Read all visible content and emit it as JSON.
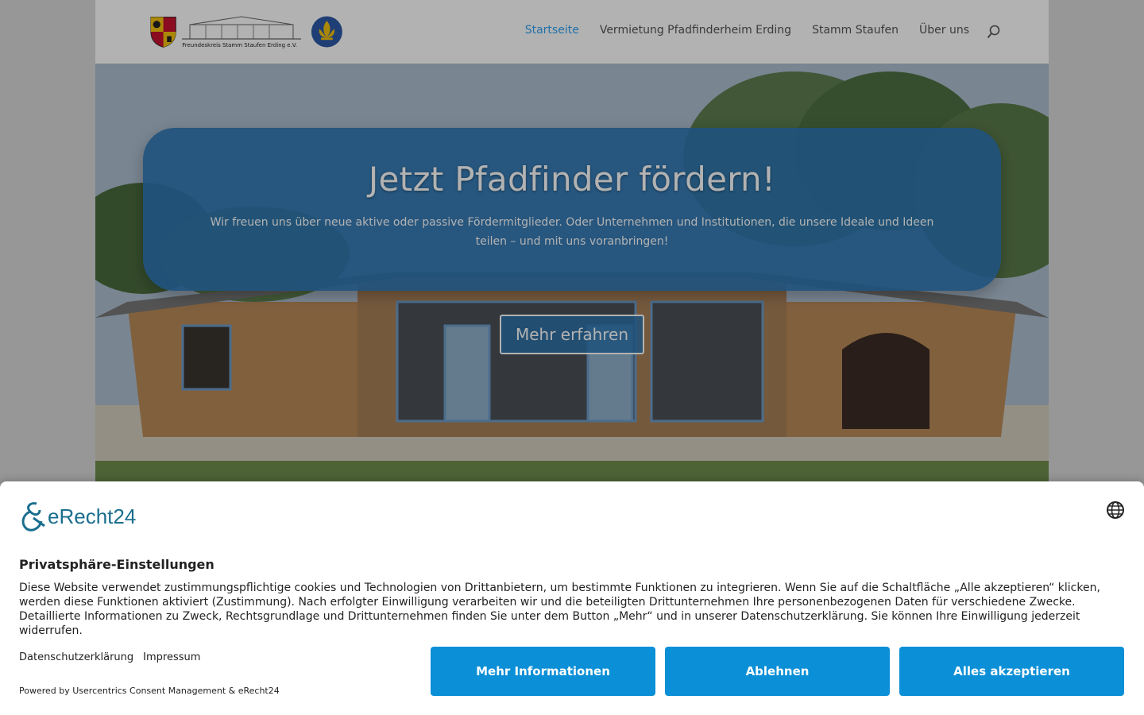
{
  "header": {
    "logo_text": "Freundeskreis Stamm Staufen Erding e.V.",
    "nav": [
      {
        "label": "Startseite",
        "active": true
      },
      {
        "label": "Vermietung Pfadfinderheim Erding",
        "active": false
      },
      {
        "label": "Stamm Staufen",
        "active": false
      },
      {
        "label": "Über uns",
        "active": false
      }
    ],
    "search_icon": "search-icon"
  },
  "hero": {
    "title": "Jetzt Pfadfinder fördern!",
    "text": "Wir freuen uns über neue aktive oder passive Fördermitglieder. Oder Unternehmen und Institutionen, die unsere Ideale und Ideen teilen – und mit uns voranbringen!",
    "button_label": "Mehr erfahren"
  },
  "consent": {
    "brand": "eRecht24",
    "language_icon": "globe-icon",
    "title": "Privatsphäre-Einstellungen",
    "body": "Diese Website verwendet zustimmungspflichtige cookies und Technologien von Drittanbietern, um bestimmte Funktionen zu integrieren. Wenn Sie auf die Schaltfläche „Alle akzeptieren“ klicken, werden diese Funktionen aktiviert (Zustimmung). Nach erfolgter Einwilligung verarbeiten wir und die beteiligten Drittunternehmen Ihre personenbezogenen Daten für verschiedene Zwecke. Detaillierte Informationen zu Zweck, Rechtsgrundlage und Drittunternehmen finden Sie unter dem Button „Mehr“ und in unserer Datenschutzerklärung. Sie können Ihre Einwilligung jederzeit widerrufen.",
    "links": [
      "Datenschutzerklärung",
      "Impressum"
    ],
    "powered_by": "Powered by Usercentrics Consent Management & eRecht24",
    "buttons": [
      "Mehr Informationen",
      "Ablehnen",
      "Alles akzeptieren"
    ]
  },
  "colors": {
    "accent": "#2ea3f2",
    "promo_bg": "#2e76b2",
    "consent_button": "#0b8fd6",
    "brand": "#1a6e8e"
  }
}
